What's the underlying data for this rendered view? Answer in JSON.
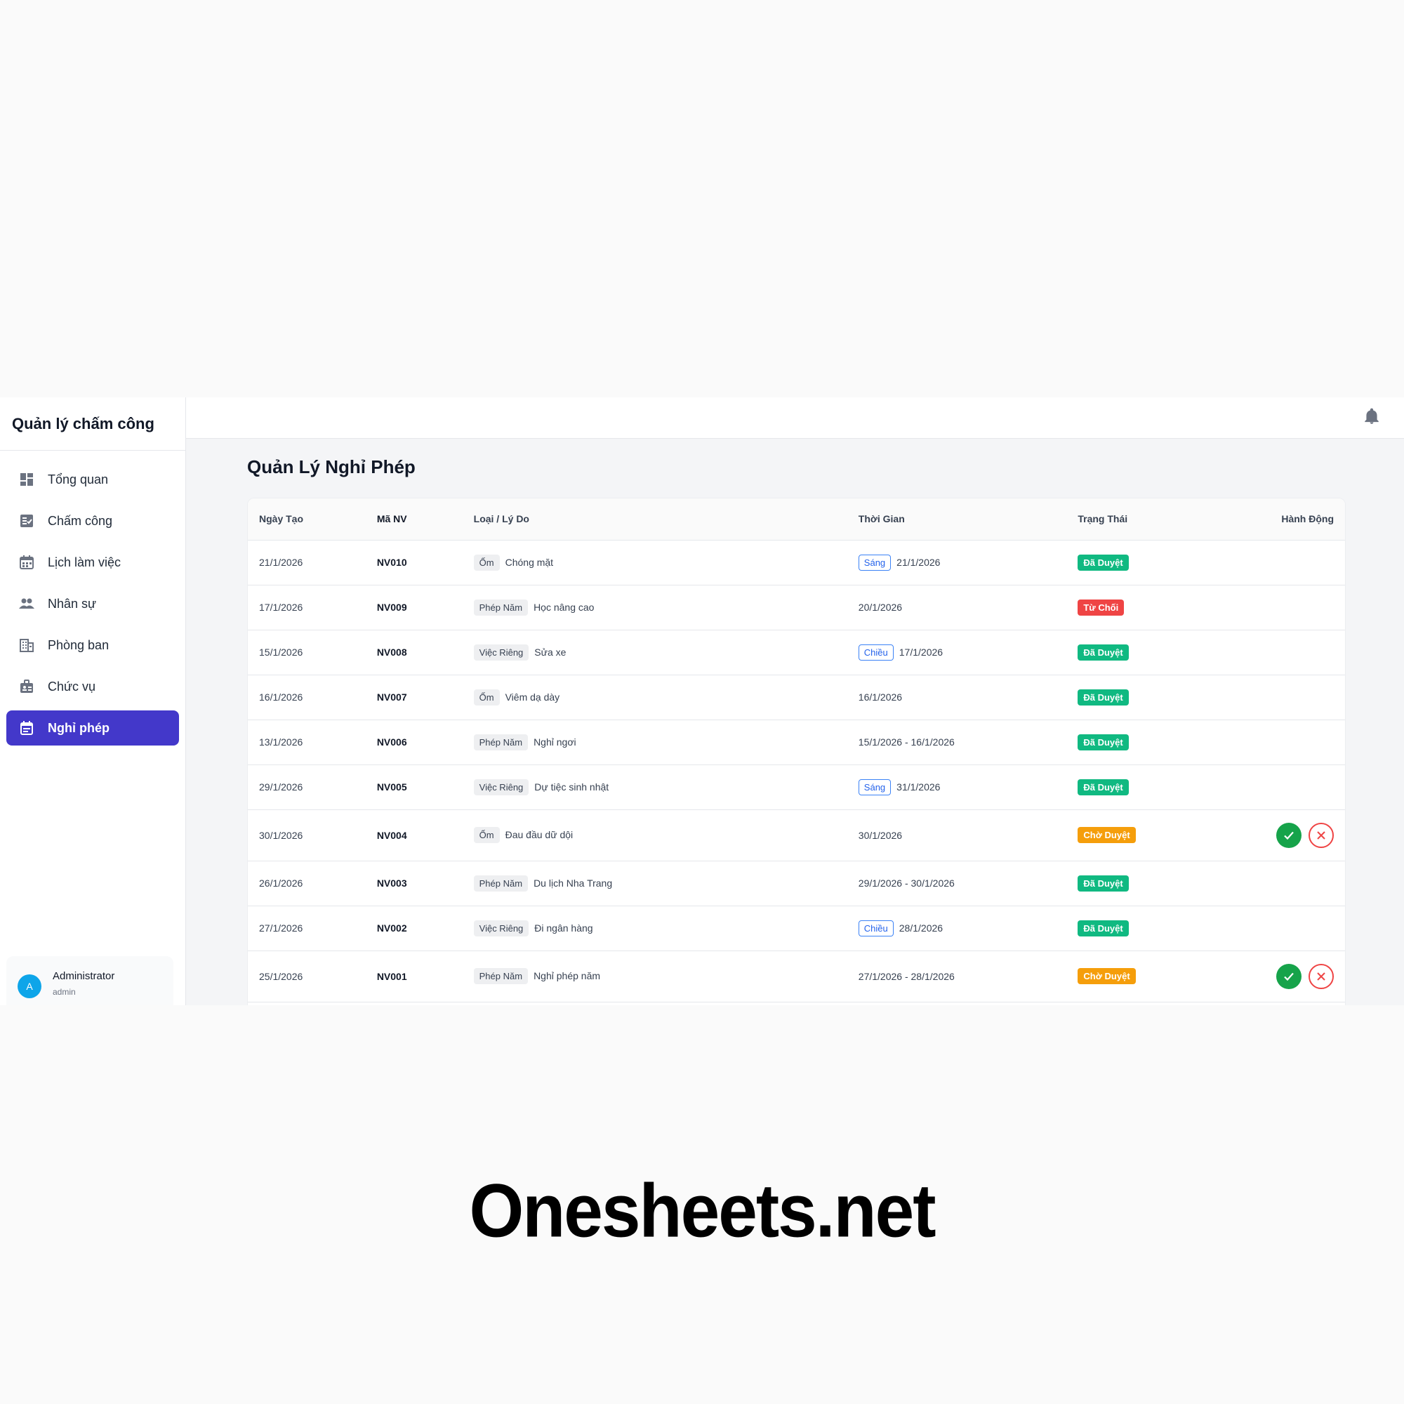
{
  "app": {
    "title": "Quản lý chấm công"
  },
  "sidebar": {
    "items": [
      {
        "label": "Tổng quan",
        "icon": "dashboard-icon"
      },
      {
        "label": "Chấm công",
        "icon": "checklist-icon"
      },
      {
        "label": "Lịch làm việc",
        "icon": "calendar-icon"
      },
      {
        "label": "Nhân sự",
        "icon": "people-icon"
      },
      {
        "label": "Phòng ban",
        "icon": "building-icon"
      },
      {
        "label": "Chức vụ",
        "icon": "badge-icon"
      },
      {
        "label": "Nghỉ phép",
        "icon": "leave-calendar-icon",
        "active": true
      }
    ],
    "user": {
      "initial": "A",
      "name": "Administrator",
      "role": "admin"
    }
  },
  "header": {
    "icon": "bell-icon"
  },
  "main": {
    "title": "Quản Lý Nghỉ Phép",
    "columns": [
      "Ngày Tạo",
      "Mã NV",
      "Loại / Lý Do",
      "Thời Gian",
      "Trạng Thái",
      "Hành Động"
    ],
    "rows": [
      {
        "created": "21/1/2026",
        "emp": "NV010",
        "type": "Ốm",
        "reason": "Chóng mặt",
        "shift": "Sáng",
        "time": "21/1/2026",
        "status": "Đã Duyệt",
        "status_kind": "approved",
        "actions": false
      },
      {
        "created": "17/1/2026",
        "emp": "NV009",
        "type": "Phép Năm",
        "reason": "Học nâng cao",
        "shift": "",
        "time": "20/1/2026",
        "status": "Từ Chối",
        "status_kind": "rejected",
        "actions": false
      },
      {
        "created": "15/1/2026",
        "emp": "NV008",
        "type": "Việc Riêng",
        "reason": "Sửa xe",
        "shift": "Chiều",
        "time": "17/1/2026",
        "status": "Đã Duyệt",
        "status_kind": "approved",
        "actions": false
      },
      {
        "created": "16/1/2026",
        "emp": "NV007",
        "type": "Ốm",
        "reason": "Viêm dạ dày",
        "shift": "",
        "time": "16/1/2026",
        "status": "Đã Duyệt",
        "status_kind": "approved",
        "actions": false
      },
      {
        "created": "13/1/2026",
        "emp": "NV006",
        "type": "Phép Năm",
        "reason": "Nghỉ ngơi",
        "shift": "",
        "time": "15/1/2026 - 16/1/2026",
        "status": "Đã Duyệt",
        "status_kind": "approved",
        "actions": false
      },
      {
        "created": "29/1/2026",
        "emp": "NV005",
        "type": "Việc Riêng",
        "reason": "Dự tiệc sinh nhật",
        "shift": "Sáng",
        "time": "31/1/2026",
        "status": "Đã Duyệt",
        "status_kind": "approved",
        "actions": false
      },
      {
        "created": "30/1/2026",
        "emp": "NV004",
        "type": "Ốm",
        "reason": "Đau đầu dữ dội",
        "shift": "",
        "time": "30/1/2026",
        "status": "Chờ Duyệt",
        "status_kind": "pending",
        "actions": true
      },
      {
        "created": "26/1/2026",
        "emp": "NV003",
        "type": "Phép Năm",
        "reason": "Du lịch Nha Trang",
        "shift": "",
        "time": "29/1/2026 - 30/1/2026",
        "status": "Đã Duyệt",
        "status_kind": "approved",
        "actions": false
      },
      {
        "created": "27/1/2026",
        "emp": "NV002",
        "type": "Việc Riêng",
        "reason": "Đi ngân hàng",
        "shift": "Chiều",
        "time": "28/1/2026",
        "status": "Đã Duyệt",
        "status_kind": "approved",
        "actions": false
      },
      {
        "created": "25/1/2026",
        "emp": "NV001",
        "type": "Phép Năm",
        "reason": "Nghỉ phép năm",
        "shift": "",
        "time": "27/1/2026 - 28/1/2026",
        "status": "Chờ Duyệt",
        "status_kind": "pending",
        "actions": true
      }
    ]
  },
  "colors": {
    "accent": "#4338ca",
    "approved": "#10b981",
    "rejected": "#ef4444",
    "pending": "#f59e0b"
  },
  "watermark": "Onesheets.net"
}
